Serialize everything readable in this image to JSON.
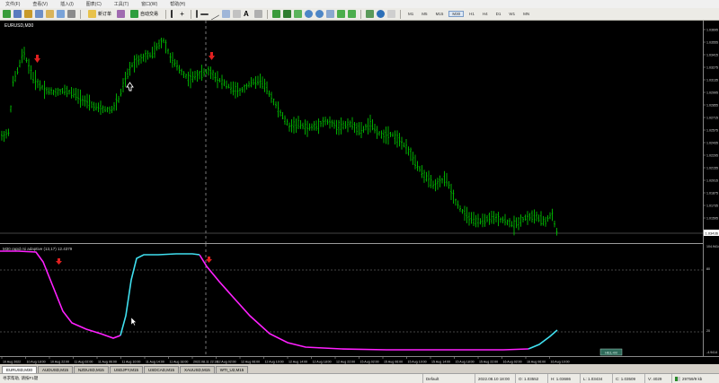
{
  "menu": [
    "文件(F)",
    "查看(V)",
    "插入(I)",
    "图表(C)",
    "工具(T)",
    "窗口(W)",
    "帮助(H)"
  ],
  "toolbar": {
    "new_order_label": "新订单",
    "autotrade_label": "自动交易",
    "timeframes": [
      "M1",
      "M5",
      "M15",
      "M30",
      "H1",
      "H4",
      "D1",
      "W1",
      "MN"
    ]
  },
  "main_chart": {
    "label": "EURUSD,M30",
    "current_price": "1.03436",
    "price_ticks": [
      "1.03695",
      "1.03555",
      "1.03415",
      "1.03275",
      "1.03135",
      "1.02995",
      "1.02855",
      "1.02715",
      "1.02575",
      "1.02435",
      "1.02295",
      "1.02155",
      "1.02015",
      "1.01875",
      "1.01735",
      "1.01595",
      "1.01455"
    ]
  },
  "indicator": {
    "label": "M30 rapid rsi adaptive (13,17) 12.4379",
    "ticks": [
      "104.9414",
      "80",
      "20",
      "-4.9414"
    ],
    "badge": "HEL+M"
  },
  "xaxis": {
    "labels": [
      "10 Aug 2022",
      "10 Aug 18:00",
      "10 Aug 22:00",
      "11 Aug 02:00",
      "11 Aug 06:00",
      "11 Aug 10:00",
      "11 Aug 14:00",
      "11 Aug 18:00",
      "2022.08.11 22:30",
      "12 Aug 02:00",
      "12 Aug 06:00",
      "12 Aug 10:00",
      "12 Aug 14:00",
      "12 Aug 18:00",
      "12 Aug 22:00",
      "15 Aug 02:00",
      "15 Aug 06:00",
      "15 Aug 10:00",
      "15 Aug 14:00",
      "15 Aug 18:00",
      "15 Aug 22:00",
      "16 Aug 02:00",
      "16 Aug 06:00",
      "16 Aug 10:00"
    ]
  },
  "tabs": [
    "EURUSD,M30",
    "AUDUSD,M15",
    "NZDUSD,M15",
    "USDJPY,M15",
    "USDCAD,M15",
    "XAUUSD,M15",
    "WTI_U2,M15"
  ],
  "status": {
    "help": "寻求帮助, 请按F1键",
    "profile": "Default",
    "datetime": "2022.08.10 18:00",
    "open": "O: 1.03552",
    "high": "H: 1.03686",
    "low": "L: 1.03434",
    "close": "C: 1.03509",
    "volume": "V: 4029",
    "traffic": "29759/9 kb"
  },
  "colors": {
    "candle": "#00c000",
    "rsi_up": "#40e0f0",
    "rsi_down": "#ff20ff",
    "arrow": "#e00000"
  }
}
